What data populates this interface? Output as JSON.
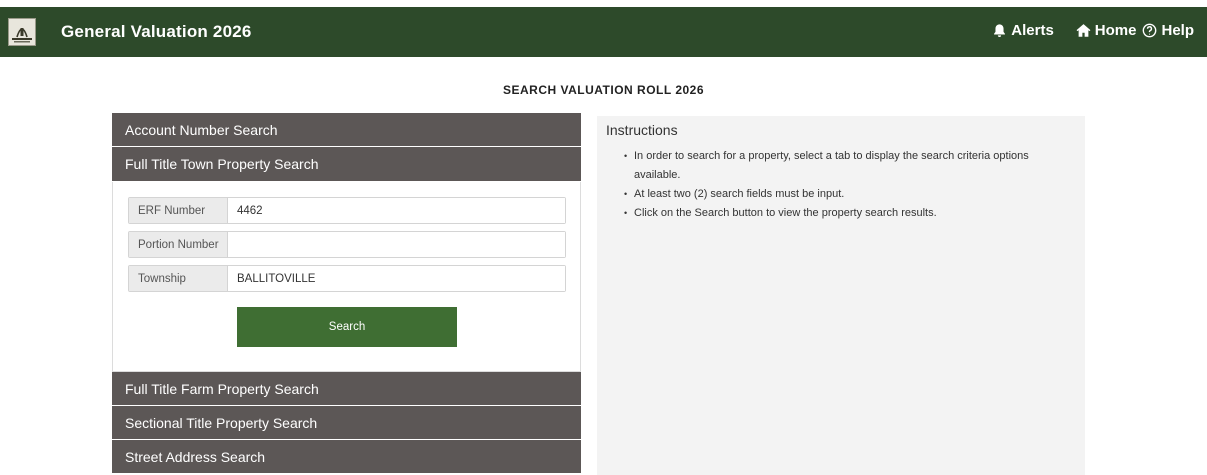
{
  "header": {
    "title": "General Valuation 2026",
    "nav": {
      "alerts": "Alerts",
      "home": "Home",
      "help": "Help"
    }
  },
  "page_title": "SEARCH VALUATION ROLL 2026",
  "accordion": {
    "top_tabs": [
      "Account Number Search",
      "Full Title Town Property Search"
    ],
    "form": {
      "erf_label": "ERF Number",
      "erf_value": "4462",
      "portion_label": "Portion Number",
      "portion_value": "",
      "township_label": "Township",
      "township_value": "BALLITOVILLE",
      "search_label": "Search"
    },
    "bottom_tabs": [
      "Full Title Farm Property Search",
      "Sectional Title Property Search",
      "Street Address Search"
    ]
  },
  "instructions": {
    "title": "Instructions",
    "items": [
      "In order to search for a property, select a tab to display the search criteria options available.",
      "At least two (2) search fields must be input.",
      "Click on the Search button to view the property search results."
    ]
  },
  "colors": {
    "header_bg": "#2d4a2a",
    "tab_bg": "#5c5756",
    "button_bg": "#3f6e33",
    "instructions_bg": "#f3f3f3"
  }
}
